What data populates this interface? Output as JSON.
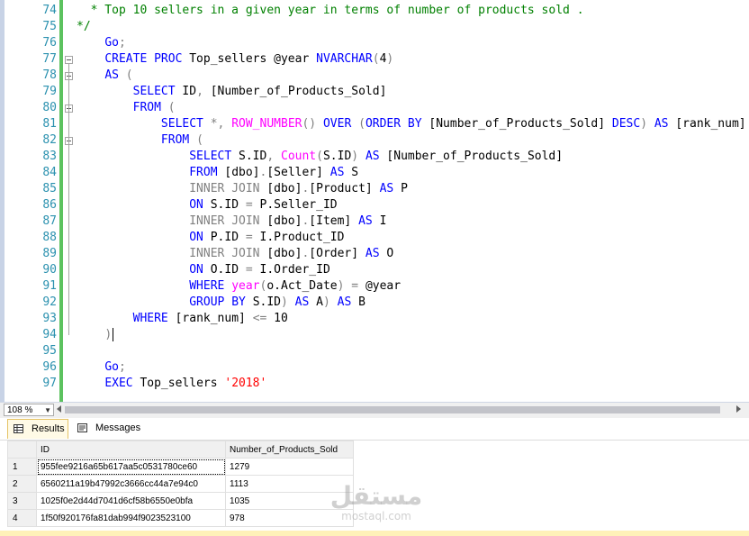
{
  "editor": {
    "lines": [
      {
        "n": "74",
        "tokens": [
          {
            "t": "cm",
            "v": "  * Top 10 sellers in a given year in terms of number of products sold ."
          }
        ]
      },
      {
        "n": "75",
        "tokens": [
          {
            "t": "cm",
            "v": "*/"
          }
        ]
      },
      {
        "n": "76",
        "tokens": [
          {
            "t": "",
            "v": "    "
          },
          {
            "t": "kw",
            "v": "Go"
          },
          {
            "t": "op",
            "v": ";"
          }
        ]
      },
      {
        "n": "77",
        "fold": true,
        "tokens": [
          {
            "t": "",
            "v": "    "
          },
          {
            "t": "kw",
            "v": "CREATE PROC "
          },
          {
            "t": "",
            "v": "Top_sellers @year "
          },
          {
            "t": "kw",
            "v": "NVARCHAR"
          },
          {
            "t": "op",
            "v": "("
          },
          {
            "t": "",
            "v": "4"
          },
          {
            "t": "op",
            "v": ")"
          }
        ]
      },
      {
        "n": "78",
        "fold": true,
        "tokens": [
          {
            "t": "",
            "v": "    "
          },
          {
            "t": "kw",
            "v": "AS "
          },
          {
            "t": "op",
            "v": "("
          }
        ]
      },
      {
        "n": "79",
        "tokens": [
          {
            "t": "",
            "v": "        "
          },
          {
            "t": "kw",
            "v": "SELECT "
          },
          {
            "t": "",
            "v": "ID"
          },
          {
            "t": "op",
            "v": ", "
          },
          {
            "t": "",
            "v": "[Number_of_Products_Sold]"
          }
        ]
      },
      {
        "n": "80",
        "fold": true,
        "tokens": [
          {
            "t": "",
            "v": "        "
          },
          {
            "t": "kw",
            "v": "FROM "
          },
          {
            "t": "op",
            "v": "("
          }
        ]
      },
      {
        "n": "81",
        "tokens": [
          {
            "t": "",
            "v": "            "
          },
          {
            "t": "kw",
            "v": "SELECT "
          },
          {
            "t": "op",
            "v": "*, "
          },
          {
            "t": "fn",
            "v": "ROW_NUMBER"
          },
          {
            "t": "op",
            "v": "() "
          },
          {
            "t": "kw",
            "v": "OVER "
          },
          {
            "t": "op",
            "v": "("
          },
          {
            "t": "kw",
            "v": "ORDER BY "
          },
          {
            "t": "",
            "v": "[Number_of_Products_Sold] "
          },
          {
            "t": "kw",
            "v": "DESC"
          },
          {
            "t": "op",
            "v": ") "
          },
          {
            "t": "kw",
            "v": "AS "
          },
          {
            "t": "",
            "v": "[rank_num]"
          }
        ]
      },
      {
        "n": "82",
        "fold": true,
        "tokens": [
          {
            "t": "",
            "v": "            "
          },
          {
            "t": "kw",
            "v": "FROM "
          },
          {
            "t": "op",
            "v": "("
          }
        ]
      },
      {
        "n": "83",
        "tokens": [
          {
            "t": "",
            "v": "                "
          },
          {
            "t": "kw",
            "v": "SELECT "
          },
          {
            "t": "",
            "v": "S.ID"
          },
          {
            "t": "op",
            "v": ", "
          },
          {
            "t": "fn",
            "v": "Count"
          },
          {
            "t": "op",
            "v": "("
          },
          {
            "t": "",
            "v": "S.ID"
          },
          {
            "t": "op",
            "v": ") "
          },
          {
            "t": "kw",
            "v": "AS "
          },
          {
            "t": "",
            "v": "[Number_of_Products_Sold]"
          }
        ]
      },
      {
        "n": "84",
        "tokens": [
          {
            "t": "",
            "v": "                "
          },
          {
            "t": "kw",
            "v": "FROM "
          },
          {
            "t": "",
            "v": "[dbo]"
          },
          {
            "t": "op",
            "v": "."
          },
          {
            "t": "",
            "v": "[Seller] "
          },
          {
            "t": "kw",
            "v": "AS "
          },
          {
            "t": "",
            "v": "S"
          }
        ]
      },
      {
        "n": "85",
        "tokens": [
          {
            "t": "",
            "v": "                "
          },
          {
            "t": "op",
            "v": "INNER JOIN "
          },
          {
            "t": "",
            "v": "[dbo]"
          },
          {
            "t": "op",
            "v": "."
          },
          {
            "t": "",
            "v": "[Product] "
          },
          {
            "t": "kw",
            "v": "AS "
          },
          {
            "t": "",
            "v": "P"
          }
        ]
      },
      {
        "n": "86",
        "tokens": [
          {
            "t": "",
            "v": "                "
          },
          {
            "t": "kw",
            "v": "ON "
          },
          {
            "t": "",
            "v": "S.ID "
          },
          {
            "t": "op",
            "v": "= "
          },
          {
            "t": "",
            "v": "P.Seller_ID"
          }
        ]
      },
      {
        "n": "87",
        "tokens": [
          {
            "t": "",
            "v": "                "
          },
          {
            "t": "op",
            "v": "INNER JOIN "
          },
          {
            "t": "",
            "v": "[dbo]"
          },
          {
            "t": "op",
            "v": "."
          },
          {
            "t": "",
            "v": "[Item] "
          },
          {
            "t": "kw",
            "v": "AS "
          },
          {
            "t": "",
            "v": "I"
          }
        ]
      },
      {
        "n": "88",
        "tokens": [
          {
            "t": "",
            "v": "                "
          },
          {
            "t": "kw",
            "v": "ON "
          },
          {
            "t": "",
            "v": "P.ID "
          },
          {
            "t": "op",
            "v": "= "
          },
          {
            "t": "",
            "v": "I.Product_ID"
          }
        ]
      },
      {
        "n": "89",
        "tokens": [
          {
            "t": "",
            "v": "                "
          },
          {
            "t": "op",
            "v": "INNER JOIN "
          },
          {
            "t": "",
            "v": "[dbo]"
          },
          {
            "t": "op",
            "v": "."
          },
          {
            "t": "",
            "v": "[Order] "
          },
          {
            "t": "kw",
            "v": "AS "
          },
          {
            "t": "",
            "v": "O"
          }
        ]
      },
      {
        "n": "90",
        "tokens": [
          {
            "t": "",
            "v": "                "
          },
          {
            "t": "kw",
            "v": "ON "
          },
          {
            "t": "",
            "v": "O.ID "
          },
          {
            "t": "op",
            "v": "= "
          },
          {
            "t": "",
            "v": "I.Order_ID"
          }
        ]
      },
      {
        "n": "91",
        "tokens": [
          {
            "t": "",
            "v": "                "
          },
          {
            "t": "kw",
            "v": "WHERE "
          },
          {
            "t": "fn",
            "v": "year"
          },
          {
            "t": "op",
            "v": "("
          },
          {
            "t": "",
            "v": "o.Act_Date"
          },
          {
            "t": "op",
            "v": ") = "
          },
          {
            "t": "",
            "v": "@year"
          }
        ]
      },
      {
        "n": "92",
        "tokens": [
          {
            "t": "",
            "v": "                "
          },
          {
            "t": "kw",
            "v": "GROUP BY "
          },
          {
            "t": "",
            "v": "S.ID"
          },
          {
            "t": "op",
            "v": ") "
          },
          {
            "t": "kw",
            "v": "AS "
          },
          {
            "t": "",
            "v": "A"
          },
          {
            "t": "op",
            "v": ") "
          },
          {
            "t": "kw",
            "v": "AS "
          },
          {
            "t": "",
            "v": "B"
          }
        ]
      },
      {
        "n": "93",
        "tokens": [
          {
            "t": "",
            "v": "        "
          },
          {
            "t": "kw",
            "v": "WHERE "
          },
          {
            "t": "",
            "v": "[rank_num] "
          },
          {
            "t": "op",
            "v": "<= "
          },
          {
            "t": "",
            "v": "10"
          }
        ]
      },
      {
        "n": "94",
        "current": true,
        "tokens": [
          {
            "t": "",
            "v": "    "
          },
          {
            "t": "op",
            "v": ")"
          }
        ]
      },
      {
        "n": "95",
        "tokens": []
      },
      {
        "n": "96",
        "tokens": [
          {
            "t": "",
            "v": "    "
          },
          {
            "t": "kw",
            "v": "Go"
          },
          {
            "t": "op",
            "v": ";"
          }
        ]
      },
      {
        "n": "97",
        "tokens": [
          {
            "t": "",
            "v": "    "
          },
          {
            "t": "kw",
            "v": "EXEC "
          },
          {
            "t": "",
            "v": "Top_sellers "
          },
          {
            "t": "st",
            "v": "'2018'"
          }
        ]
      }
    ]
  },
  "toolbar": {
    "zoom": "108 %"
  },
  "results": {
    "tabs": {
      "results": "Results",
      "messages": "Messages"
    },
    "columns": [
      "ID",
      "Number_of_Products_Sold"
    ],
    "rows": [
      {
        "n": "1",
        "id": "955fee9216a65b617aa5c0531780ce60",
        "count": "1279"
      },
      {
        "n": "2",
        "id": "6560211a19b47992c3666cc44a7e94c0",
        "count": "1113"
      },
      {
        "n": "3",
        "id": "1025f0e2d44d7041d6cf58b6550e0bfa",
        "count": "1035"
      },
      {
        "n": "4",
        "id": "1f50f920176fa81dab994f9023523100",
        "count": "978"
      }
    ]
  },
  "watermark": {
    "arabic": "مستقل",
    "latin": "mostaql.com"
  },
  "colors": {
    "keyword": "#0000ff",
    "function": "#ff00ff",
    "operator": "#808080",
    "comment": "#008000",
    "string": "#ff0000",
    "line_number": "#2b91af",
    "change_bar": "#5cc25f"
  }
}
